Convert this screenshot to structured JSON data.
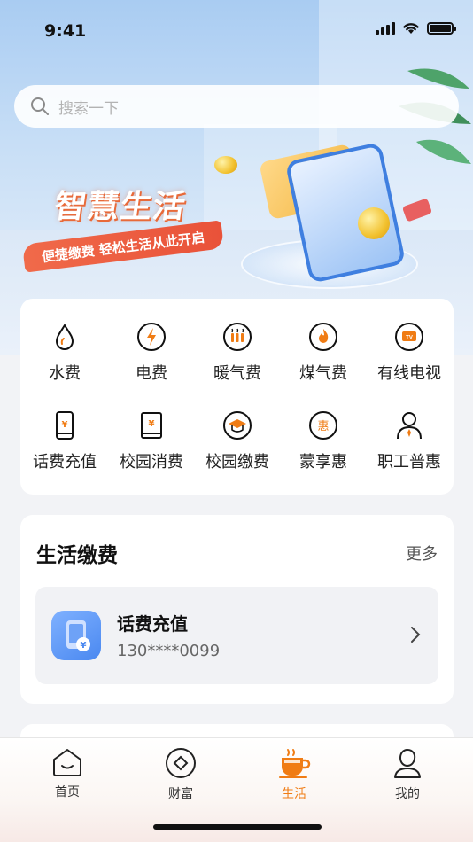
{
  "status_bar": {
    "time": "9:41"
  },
  "search": {
    "placeholder": "搜索一下"
  },
  "banner": {
    "title": "智慧生活",
    "subtitle": "便捷缴费 轻松生活从此开启"
  },
  "services": [
    {
      "label": "水费",
      "icon": "water-drop-icon"
    },
    {
      "label": "电费",
      "icon": "lightning-icon"
    },
    {
      "label": "暖气费",
      "icon": "heater-icon"
    },
    {
      "label": "煤气费",
      "icon": "flame-icon"
    },
    {
      "label": "有线电视",
      "icon": "tv-icon"
    },
    {
      "label": "话费充值",
      "icon": "phone-yuan-icon"
    },
    {
      "label": "校园消费",
      "icon": "book-yuan-icon"
    },
    {
      "label": "校园缴费",
      "icon": "graduation-cap-icon"
    },
    {
      "label": "蒙享惠",
      "icon": "discount-icon",
      "glyph": "惠"
    },
    {
      "label": "职工普惠",
      "icon": "employee-icon"
    }
  ],
  "life_section": {
    "title": "生活缴费",
    "more": "更多",
    "item": {
      "name": "话费充值",
      "number": "130****0099"
    }
  },
  "tabbar": {
    "tabs": [
      {
        "label": "首页",
        "icon": "home-icon"
      },
      {
        "label": "财富",
        "icon": "wealth-icon"
      },
      {
        "label": "生活",
        "icon": "coffee-cup-icon",
        "active": true
      },
      {
        "label": "我的",
        "icon": "profile-icon"
      }
    ]
  },
  "colors": {
    "accent": "#f07c14",
    "ribbon": "#e95239",
    "app_icon": "#4a88f0"
  }
}
